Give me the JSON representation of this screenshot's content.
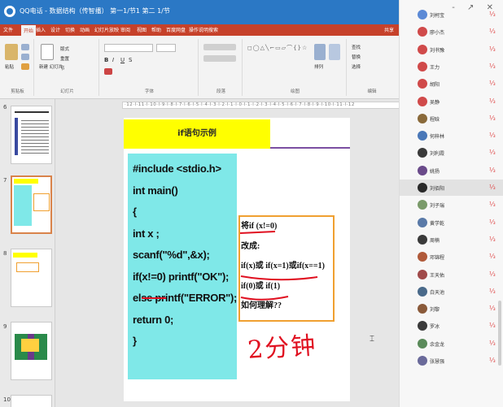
{
  "window": {
    "title": "QQ电话 - 数据结构（传智播） 第一1/节1 第二 1/节",
    "controls": "- ↗ ✕"
  },
  "ribbon": {
    "tabs": [
      "文件",
      "开始",
      "插入",
      "设计",
      "切换",
      "动画",
      "幻灯片放映",
      "审阅",
      "视图",
      "帮助",
      "百度网盘",
      "操作说明搜索"
    ],
    "active_tab": "开始",
    "share": "共享",
    "groups": {
      "clipboard": "剪贴板",
      "slides": "幻灯片",
      "font": "字体",
      "paragraph": "段落",
      "drawing": "绘图",
      "editing": "编辑"
    },
    "buttons": {
      "paste": "粘贴",
      "new_slide": "新建\n幻灯片",
      "layout": "版式",
      "reset": "重置",
      "section": "节",
      "arrange": "排列",
      "find": "查找",
      "replace": "替换",
      "select": "选择"
    },
    "shapes_glyphs": "◻◯△╲⌐▭▱⌒{}☆",
    "ruler_text": "·12·l·11·l·10·l·9·l·8·l·7·l·6·l·5·l·4·l·3·l·2·l·1·l·0·l·1·l·2·l·3·l·4·l·5·l·6·l·7·l·8·l·9·l·10·l·11·l·12"
  },
  "slide_panel": {
    "numbers": [
      "6",
      "7",
      "8",
      "9",
      "10"
    ]
  },
  "slide": {
    "title": "if语句示例",
    "code_lines": [
      "#include  <stdio.h>",
      "int  main()",
      "{",
      "  int  x ;",
      "  scanf(\"%d\",&x);",
      "  if(x!=0)  printf(\"OK\");",
      "  else  printf(\"ERROR\");",
      "  return 0;",
      "}"
    ],
    "note_lines": [
      "将if (x!=0)",
      "改成:",
      " if(x)或 if(x=1)或if(x==1)",
      "if(0)或 if(1)",
      "如何理解??"
    ],
    "handwriting": "2分钟"
  },
  "members": [
    {
      "name": "刘柯宝",
      "color": "#5c8ad6"
    },
    {
      "name": "廖小杰",
      "color": "#d04a4a"
    },
    {
      "name": "刘书豫",
      "color": "#d04a4a"
    },
    {
      "name": "王力",
      "color": "#d04a4a"
    },
    {
      "name": "胡阳",
      "color": "#d04a4a"
    },
    {
      "name": "吴静",
      "color": "#d04a4a"
    },
    {
      "name": "程晗",
      "color": "#8a6a3a"
    },
    {
      "name": "何梓林",
      "color": "#4a78b8"
    },
    {
      "name": "刘利霞",
      "color": "#3a3a3a"
    },
    {
      "name": "姚扬",
      "color": "#6a4a8a"
    },
    {
      "name": "刘佰阳",
      "color": "#2a2a2a"
    },
    {
      "name": "刘子瑞",
      "color": "#7a9a6a"
    },
    {
      "name": "黄学乾",
      "color": "#5a7aa8"
    },
    {
      "name": "周楠",
      "color": "#3a3a3a"
    },
    {
      "name": "邓锦程",
      "color": "#b05a3a"
    },
    {
      "name": "王天佑",
      "color": "#a04a4a"
    },
    {
      "name": "白天池",
      "color": "#4a6a8a"
    },
    {
      "name": "刘黎",
      "color": "#8a5a3a"
    },
    {
      "name": "罗冰",
      "color": "#3a3a3a"
    },
    {
      "name": "余金龙",
      "color": "#5a8a5a"
    },
    {
      "name": "张慧强",
      "color": "#6a6a9a"
    }
  ],
  "selected_member": "刘佰阳"
}
